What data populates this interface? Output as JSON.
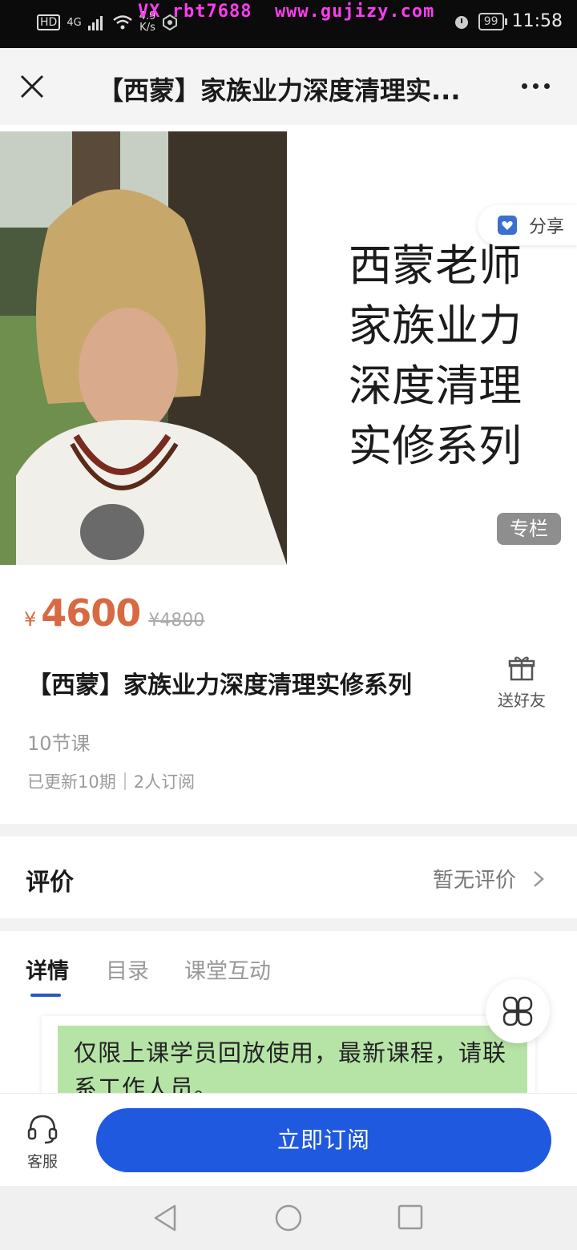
{
  "status_bar": {
    "hd": "HD",
    "network": "4G",
    "speed_value": "4.9",
    "speed_unit": "K/s",
    "watermark": "VX rbt7688  www.gujizy.com",
    "battery": "99",
    "time": "11:58"
  },
  "header": {
    "title": "【西蒙】家族业力深度清理实..."
  },
  "banner": {
    "lines": [
      "西蒙老师",
      "家族业力",
      "深度清理",
      "实修系列"
    ],
    "share_label": "分享",
    "tag": "专栏"
  },
  "course": {
    "currency": "¥",
    "price": "4600",
    "original_price": "¥4800",
    "title": "【西蒙】家族业力深度清理实修系列",
    "gift_label": "送好友",
    "lessons": "10节课",
    "updated": "已更新10期",
    "subscribers": "2人订阅"
  },
  "review": {
    "label": "评价",
    "value": "暂无评价"
  },
  "tabs": [
    {
      "label": "详情",
      "active": true
    },
    {
      "label": "目录",
      "active": false
    },
    {
      "label": "课堂互动",
      "active": false
    }
  ],
  "detail": {
    "notice": "仅限上课学员回放使用，最新课程，请联系工作人员。"
  },
  "bottom": {
    "customer_service": "客服",
    "subscribe": "立即订阅"
  },
  "colors": {
    "price": "#d76a43",
    "accent": "#1f59df",
    "watermark": "#ff3cf0",
    "notice_bg": "#b6e4a7"
  },
  "icons": [
    "close-icon",
    "more-icon",
    "share-icon",
    "gift-icon",
    "chevron-right-icon",
    "grid-icon",
    "headset-icon",
    "back-icon",
    "home-icon",
    "recents-icon"
  ]
}
